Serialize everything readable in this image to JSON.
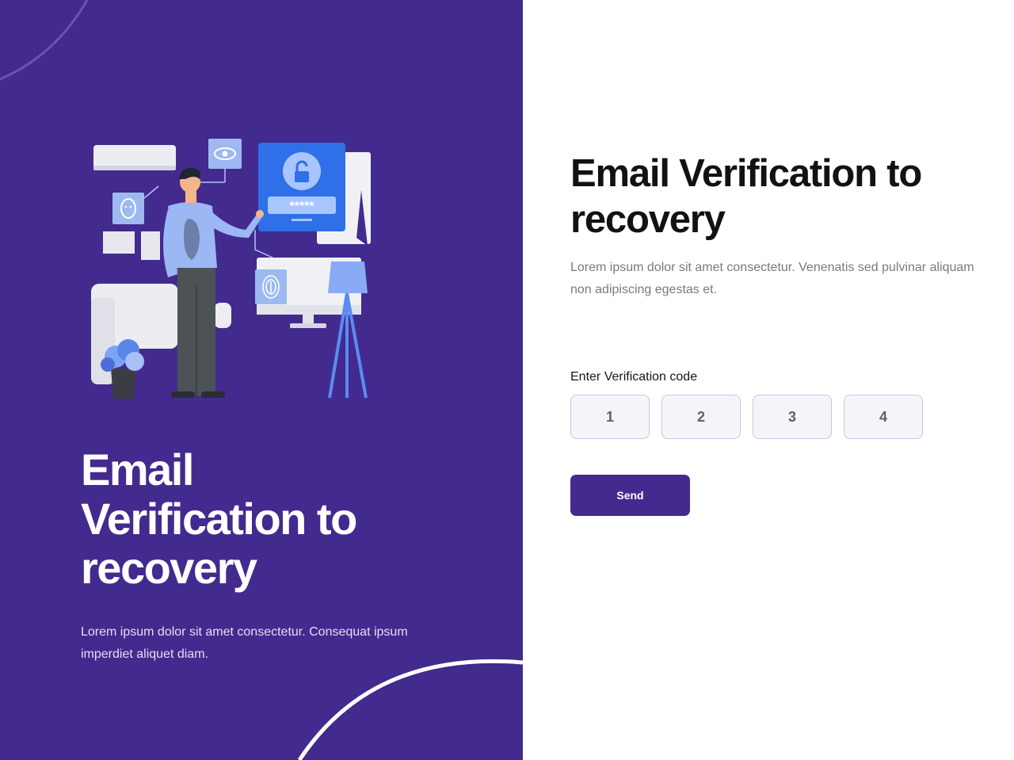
{
  "left": {
    "title": "Email Verification to recovery",
    "description": "Lorem ipsum dolor sit amet consectetur. Consequat ipsum imperdiet aliquet diam.",
    "illustration": {
      "password_mask": "*****"
    }
  },
  "right": {
    "title": "Email Verification to recovery",
    "description": "Lorem ipsum dolor sit amet consectetur. Venenatis sed pulvinar aliquam non adipiscing egestas et.",
    "code_label": "Enter Verification code",
    "code_values": [
      "1",
      "2",
      "3",
      "4"
    ],
    "send_label": "Send"
  },
  "colors": {
    "brand_purple": "#432a8e",
    "accent_blue": "#2f6fe8",
    "input_border": "#c9c6e4",
    "input_bg": "#f5f5f9"
  },
  "icons": [
    "lock-icon",
    "eye-icon",
    "face-icon",
    "fingerprint-icon",
    "plant-icon",
    "lamp-icon",
    "monitor-icon"
  ]
}
